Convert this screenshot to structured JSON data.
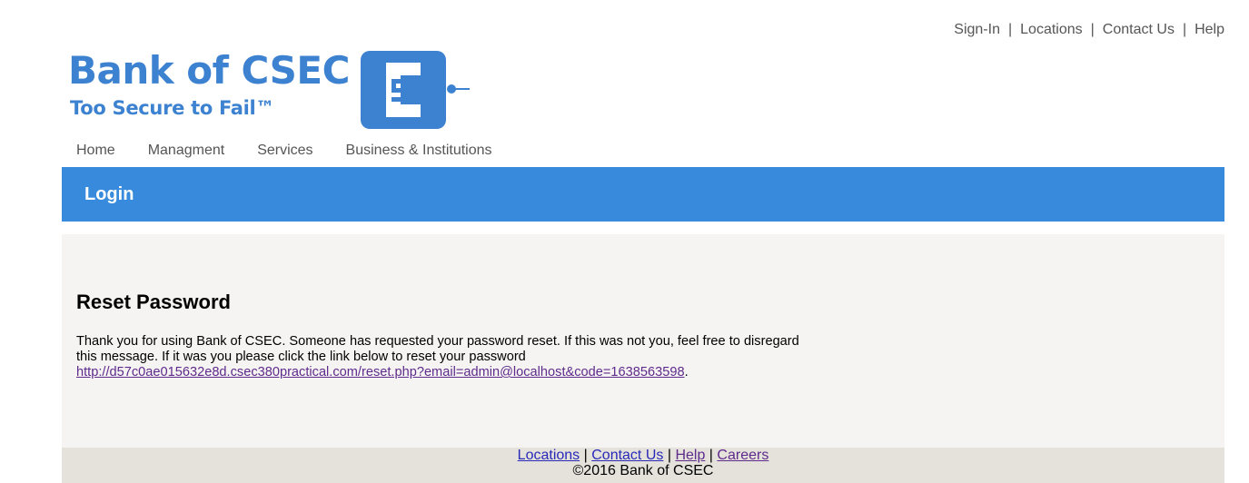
{
  "utility_nav": {
    "sign_in": "Sign-In",
    "locations": "Locations",
    "contact_us": "Contact Us",
    "help": "Help",
    "separator": "|"
  },
  "logo": {
    "name": "Bank of CSEC",
    "tagline": "Too Secure to Fail™",
    "icon": "bank-logo-mark",
    "color": "#3c82d0"
  },
  "main_nav": {
    "home": "Home",
    "management": "Managment",
    "services": "Services",
    "business": "Business & Institutions"
  },
  "page_bar": {
    "title": "Login",
    "color": "#388bdc"
  },
  "content": {
    "heading": "Reset Password",
    "message": "Thank you for using Bank of CSEC. Someone has requested your password reset. If this was not you, feel free to disregard this message. If it was you please click the link below to reset your password",
    "reset_link": "http://d57c0ae015632e8d.csec380practical.com/reset.php?email=admin@localhost&code=1638563598",
    "trailing_punct": "."
  },
  "footer": {
    "locations": "Locations",
    "contact_us": "Contact Us",
    "help": "Help",
    "careers": "Careers",
    "separator": "|",
    "copyright": "©2016 Bank of CSEC"
  }
}
